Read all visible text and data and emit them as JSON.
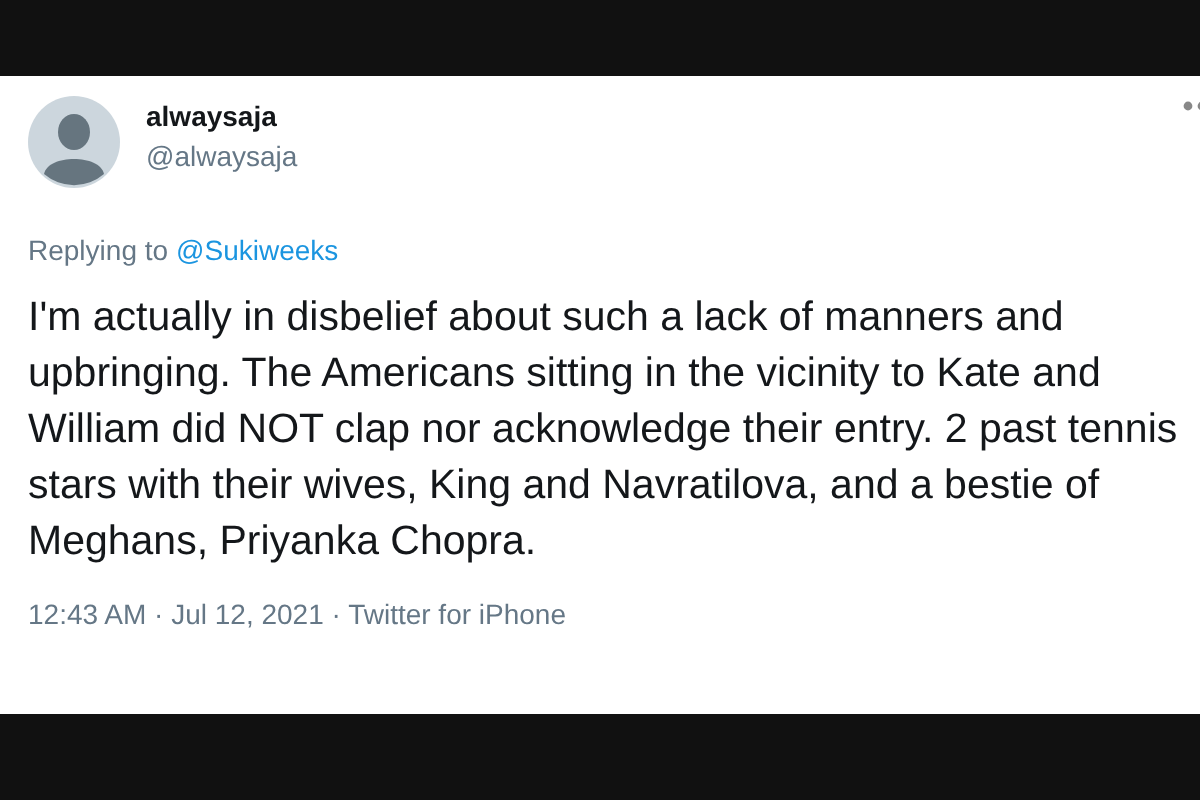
{
  "tweet": {
    "display_name": "alwaysaja",
    "handle": "@alwaysaja",
    "replying_to_label": "Replying to",
    "replying_to_handle": "@Sukiweeks",
    "text": "I'm actually in disbelief about such a lack of manners and upbringing. The Americans sitting in the vicinity to Kate and William did NOT clap nor acknowledge their entry. 2 past tennis stars with their wives, King and Navratilova, and a bestie of Meghans, Priyanka Chopra.",
    "meta": "12:43 AM · Jul 12, 2021 · Twitter for iPhone"
  }
}
